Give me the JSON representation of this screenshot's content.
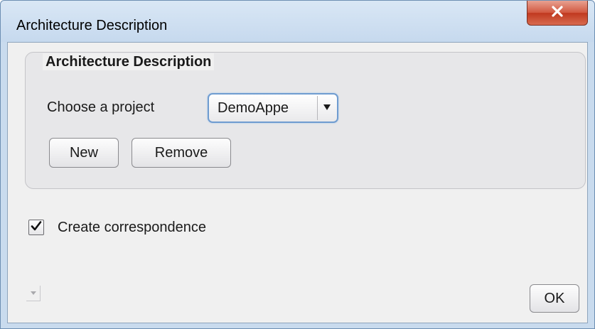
{
  "window": {
    "title": "Architecture Description"
  },
  "group": {
    "title": "Architecture Description",
    "project_label": "Choose a project",
    "project_select": {
      "selected": "DemoAppe"
    },
    "new_label": "New",
    "remove_label": "Remove"
  },
  "options": {
    "create_correspondence_label": "Create correspondence",
    "create_correspondence_checked": true
  },
  "footer": {
    "ok_label": "OK"
  },
  "colors": {
    "titlebar": "#c9dbee",
    "close_button": "#c7432a",
    "dialog_background": "#f0f0f0",
    "group_background": "#e7e7e9",
    "select_focus_border": "#6f9cd0"
  },
  "icons": {
    "close": "close-icon",
    "dropdown_arrow": "triangle-down-icon",
    "check": "checkmark-icon",
    "collapse": "small-down-arrow-icon"
  }
}
